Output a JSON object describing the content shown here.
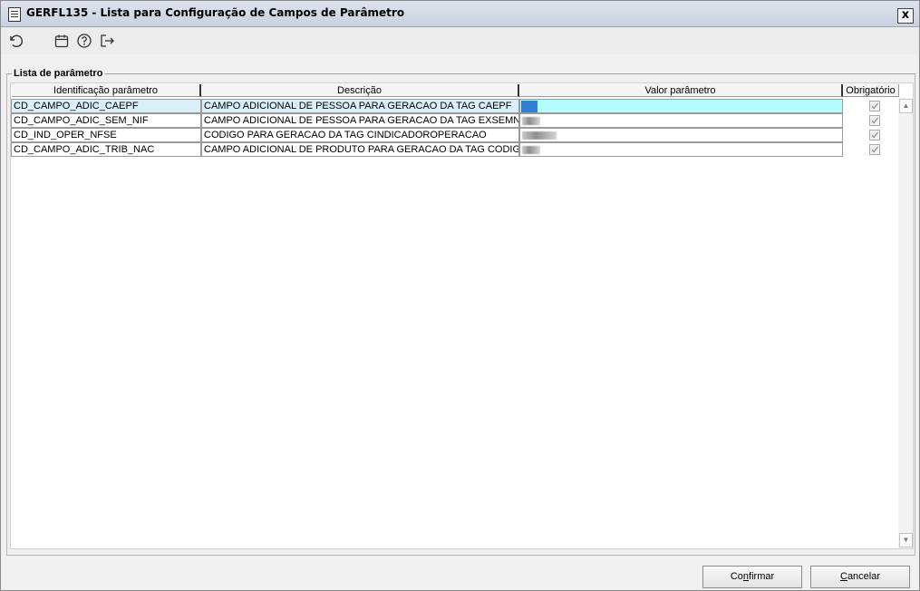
{
  "window": {
    "title": "GERFL135 - Lista para Configuração de Campos de Parâmetro",
    "close_label": "x"
  },
  "toolbar": {
    "icons": [
      "undo-icon",
      "calendar-icon",
      "help-icon",
      "exit-icon"
    ]
  },
  "group": {
    "title": "Lista de parâmetro"
  },
  "table": {
    "columns": [
      "Identificação parâmetro",
      "Descrição",
      "Valor parâmetro",
      "Obrigatório"
    ],
    "rows": [
      {
        "id": "CD_CAMPO_ADIC_CAEPF",
        "descricao": "CAMPO ADICIONAL DE PESSOA PARA GERACAO DA TAG CAEPF",
        "valor": "",
        "obrigatorio": true,
        "selected": true
      },
      {
        "id": "CD_CAMPO_ADIC_SEM_NIF",
        "descricao": "CAMPO ADICIONAL DE PESSOA PARA GERACAO DA TAG EXSEMNIF",
        "valor": "",
        "obrigatorio": true,
        "selected": false
      },
      {
        "id": "CD_IND_OPER_NFSE",
        "descricao": "CODIGO PARA GERACAO DA TAG CINDICADOROPERACAO",
        "valor": "",
        "obrigatorio": true,
        "selected": false
      },
      {
        "id": "CD_CAMPO_ADIC_TRIB_NAC",
        "descricao": "CAMPO ADICIONAL DE PRODUTO PARA GERACAO DA TAG CODIGOTRI",
        "valor": "",
        "obrigatorio": true,
        "selected": false
      }
    ]
  },
  "buttons": {
    "confirm_prefix": "Co",
    "confirm_accel": "n",
    "confirm_suffix": "firmar",
    "cancel_accel": "C",
    "cancel_suffix": "ancelar"
  },
  "colors": {
    "selected_row": "#d9f0fb",
    "selected_value": "#b4fcfd"
  }
}
